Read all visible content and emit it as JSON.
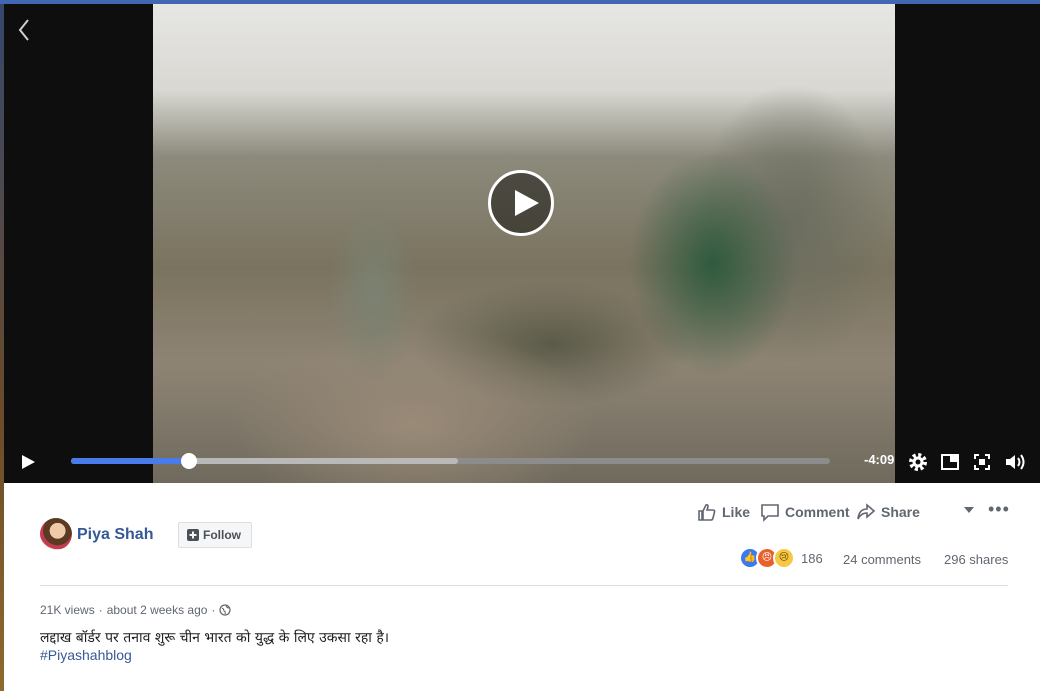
{
  "player": {
    "time_remaining": "-4:09",
    "progress_fraction": 0.156,
    "buffered_fraction": 0.51,
    "icons": {
      "back": "chevron-left-icon",
      "big_play": "play-icon",
      "play": "play-icon",
      "settings": "gear-icon",
      "mini": "picture-in-picture-icon",
      "fullscreen": "fullscreen-icon",
      "volume": "volume-icon"
    }
  },
  "post": {
    "author": "Piya Shah",
    "follow_label": "Follow",
    "actions": {
      "like": "Like",
      "comment": "Comment",
      "share": "Share"
    },
    "reaction_count": "186",
    "comments": "24 comments",
    "shares": "296 shares",
    "meta": {
      "views": "21K views",
      "time": "about 2 weeks ago"
    },
    "caption": "लद्दाख बॉर्डर पर तनाव शुरू चीन भारत को युद्ध के लिए उकसा रहा है।",
    "hashtag": "#Piyashahblog"
  },
  "colors": {
    "accent": "#4a7bea",
    "link": "#365899",
    "topbar": "#4267b2"
  }
}
